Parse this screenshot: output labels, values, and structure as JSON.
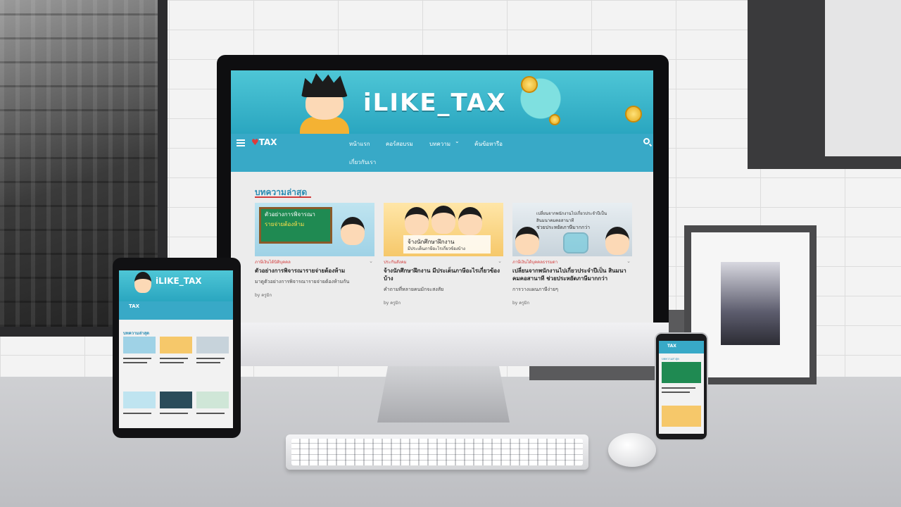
{
  "site": {
    "banner_title": "iLIKE_TAX",
    "logo_text": "TAX",
    "nav": {
      "items": [
        "หน้าแรก",
        "คอร์สอบรม",
        "บทความ",
        "ค้นข้อหารือ",
        "เกี่ยวกับเรา"
      ],
      "dropdown_indicator": "⌄"
    },
    "section_title": "บทความล่าสุด",
    "cards": [
      {
        "thumb_line1": "ตัวอย่างการพิจารณา",
        "thumb_line2": "รายจ่ายต้องห้าม",
        "category": "ภาษีเงินได้นิติบุคคล",
        "title": "ตัวอย่างการพิจารณารายจ่ายต้องห้าม",
        "excerpt": "มาดูตัวอย่างการพิจารณารายจ่ายต้องห้ามกัน",
        "author": "by  ครูมิก"
      },
      {
        "thumb_line1": "จ้างนักศึกษาฝึกงาน",
        "thumb_line2": "มีประเด็นภาษีอะไรเกี่ยวข้องบ้าง",
        "category": "ประกันสังคม",
        "title": "จ้างนักศึกษาฝึกงาน มีประเด็นภาษีอะไรเกี่ยวข้องบ้าง",
        "excerpt": "คำถามที่หลายคนมักจะสงสัย",
        "author": "by  ครูมิก"
      },
      {
        "thumb_line1": "เปลี่ยนจากพนักงานไปเกี่ยวประจำปีเป็น",
        "thumb_line2": "สินมนาคมคอสานาที",
        "thumb_line3": "ช่วยประหยัดภาษีมากกว่า",
        "category": "ภาษีเงินได้บุคคลธรรมดา",
        "title": "เปลี่ยนจากพนักงานไปเกี่ยวประจำปีเป็น สินมนาคมคอสานาที ช่วยประหยัดภาษีมากกว่า",
        "excerpt": "การวางแผนภาษีง่ายๆ",
        "author": "by  ครูมิก"
      }
    ]
  },
  "tablet": {
    "banner_title": "iLIKE_TAX",
    "logo_text": "TAX",
    "section_title": "บทความล่าสุด"
  },
  "phone": {
    "logo_text": "TAX",
    "section_title": "บทความล่าสุด"
  },
  "colors": {
    "banner": "#2aa6c0",
    "navbar": "#38a9c7",
    "accent_red": "#d23b3b",
    "section_blue": "#2a8cb3"
  }
}
